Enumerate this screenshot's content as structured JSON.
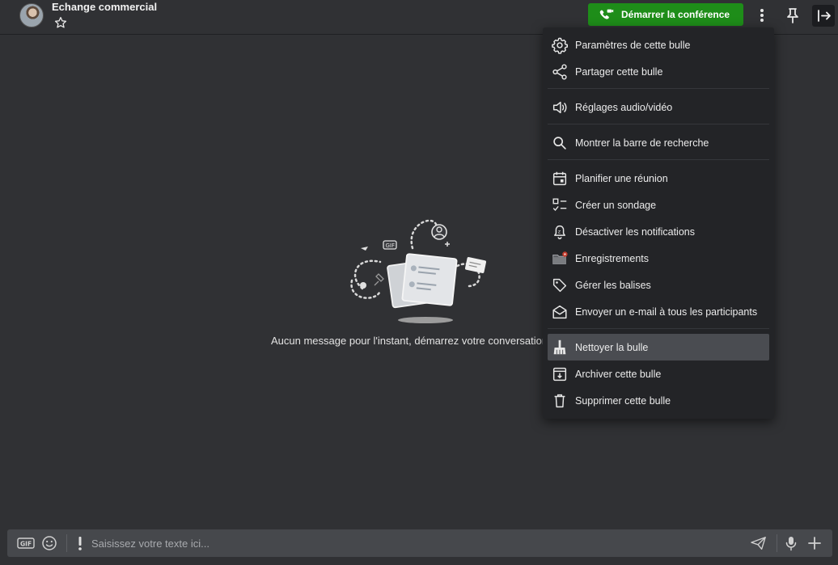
{
  "header": {
    "title": "Echange commercial",
    "conference_button": "Démarrer la conférence",
    "accent": "#1e8d19"
  },
  "main": {
    "empty_message": "Aucun message pour l'instant, démarrez votre conversation"
  },
  "menu": {
    "items": [
      {
        "label": "Paramètres de cette bulle",
        "icon": "gear-icon"
      },
      {
        "label": "Partager cette bulle",
        "icon": "share-icon"
      },
      {
        "label": "Réglages audio/vidéo",
        "icon": "speaker-icon"
      },
      {
        "label": "Montrer la barre de recherche",
        "icon": "search-icon"
      },
      {
        "label": "Planifier une réunion",
        "icon": "calendar-icon"
      },
      {
        "label": "Créer un sondage",
        "icon": "poll-icon"
      },
      {
        "label": "Désactiver les notifications",
        "icon": "bell-icon"
      },
      {
        "label": "Enregistrements",
        "icon": "recordings-folder-icon"
      },
      {
        "label": "Gérer les balises",
        "icon": "tag-icon"
      },
      {
        "label": "Envoyer un e-mail à tous les participants",
        "icon": "mail-icon"
      },
      {
        "label": "Nettoyer la bulle",
        "icon": "broom-icon"
      },
      {
        "label": "Archiver cette bulle",
        "icon": "archive-icon"
      },
      {
        "label": "Supprimer cette bulle",
        "icon": "trash-icon"
      }
    ]
  },
  "composer": {
    "placeholder": "Saisissez votre texte ici...",
    "gif_label": "GIF"
  }
}
